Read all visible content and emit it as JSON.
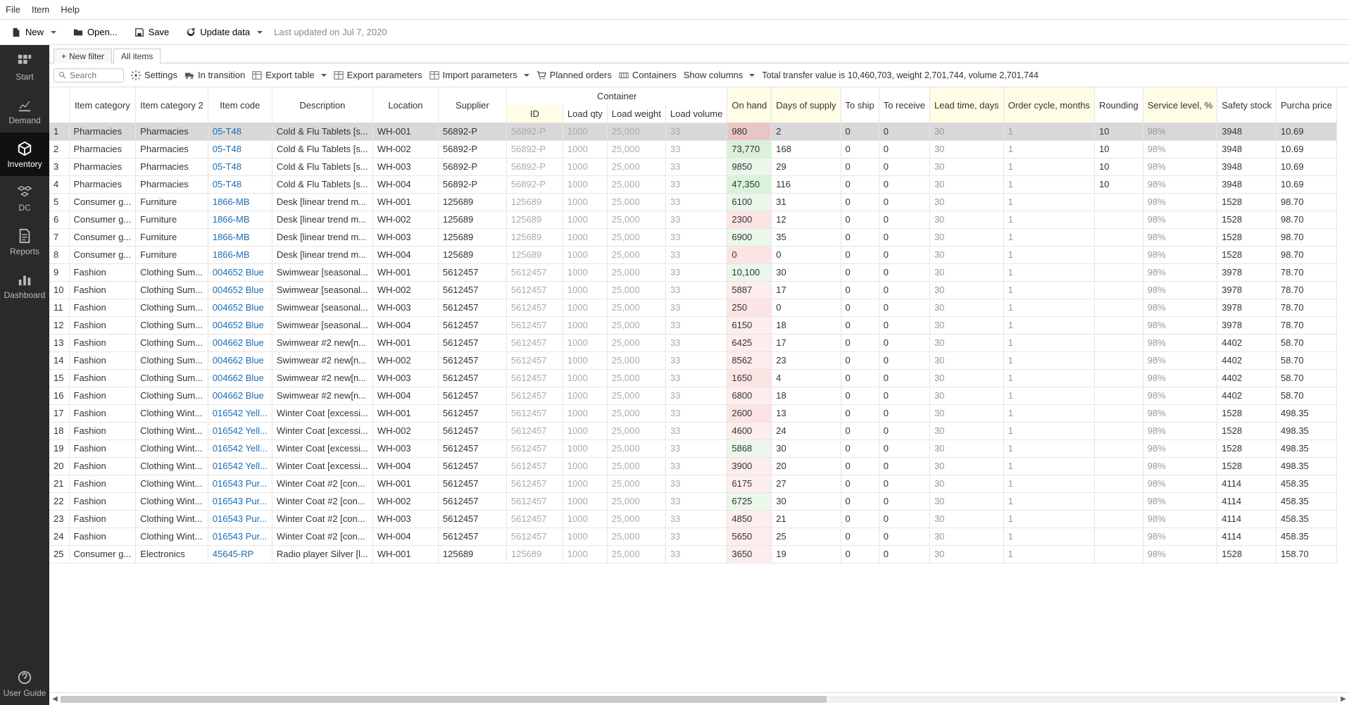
{
  "menu": {
    "file": "File",
    "item": "Item",
    "help": "Help"
  },
  "toolbar": {
    "new": "New",
    "open": "Open...",
    "save": "Save",
    "update": "Update data",
    "last_updated": "Last updated on Jul 7, 2020"
  },
  "sidebar": {
    "start": "Start",
    "demand": "Demand",
    "inventory": "Inventory",
    "dc": "DC",
    "reports": "Reports",
    "dashboard": "Dashboard",
    "guide": "User Guide"
  },
  "tabs": {
    "new_filter": "New filter",
    "all_items": "All items"
  },
  "actions": {
    "search_ph": "Search",
    "settings": "Settings",
    "in_transition": "In transition",
    "export_table": "Export table",
    "export_params": "Export parameters",
    "import_params": "Import parameters",
    "planned": "Planned orders",
    "containers": "Containers",
    "show_cols": "Show columns"
  },
  "stats": "Total transfer value is 10,460,703, weight 2,701,744, volume 2,701,744",
  "headers": {
    "cat": "Item category",
    "cat2": "Item category 2",
    "code": "Item code",
    "desc": "Description",
    "loc": "Location",
    "sup": "Supplier",
    "container": "Container",
    "cid": "ID",
    "lq": "Load qty",
    "lw": "Load weight",
    "lv": "Load volume",
    "oh": "On hand",
    "ds": "Days of supply",
    "ts": "To ship",
    "tr": "To receive",
    "lt": "Lead time, days",
    "oc": "Order cycle, months",
    "rnd": "Rounding",
    "sl": "Service level, %",
    "ss": "Safety stock",
    "pp": "Purcha price"
  },
  "rows": [
    {
      "n": 1,
      "cat": "Pharmacies",
      "cat2": "Pharmacies",
      "code": "05-T48",
      "desc": "Cold & Flu Tablets [s...",
      "loc": "WH-001",
      "sup": "56892-P",
      "cid": "56892-P",
      "lq": "1000",
      "lw": "25,000",
      "lv": "33",
      "oh": "980",
      "oh_c": "pink",
      "ds": "2",
      "ts": "0",
      "tr": "0",
      "lt": "30",
      "oc": "1",
      "rnd": "10",
      "sl": "98%",
      "ss": "3948",
      "pp": "10.69",
      "sel": true
    },
    {
      "n": 2,
      "cat": "Pharmacies",
      "cat2": "Pharmacies",
      "code": "05-T48",
      "desc": "Cold & Flu Tablets [s...",
      "loc": "WH-002",
      "sup": "56892-P",
      "cid": "56892-P",
      "lq": "1000",
      "lw": "25,000",
      "lv": "33",
      "oh": "73,770",
      "oh_c": "green",
      "ds": "168",
      "ts": "0",
      "tr": "0",
      "lt": "30",
      "oc": "1",
      "rnd": "10",
      "sl": "98%",
      "ss": "3948",
      "pp": "10.69"
    },
    {
      "n": 3,
      "cat": "Pharmacies",
      "cat2": "Pharmacies",
      "code": "05-T48",
      "desc": "Cold & Flu Tablets [s...",
      "loc": "WH-003",
      "sup": "56892-P",
      "cid": "56892-P",
      "lq": "1000",
      "lw": "25,000",
      "lv": "33",
      "oh": "9850",
      "oh_c": "lgreen",
      "ds": "29",
      "ts": "0",
      "tr": "0",
      "lt": "30",
      "oc": "1",
      "rnd": "10",
      "sl": "98%",
      "ss": "3948",
      "pp": "10.69"
    },
    {
      "n": 4,
      "cat": "Pharmacies",
      "cat2": "Pharmacies",
      "code": "05-T48",
      "desc": "Cold & Flu Tablets [s...",
      "loc": "WH-004",
      "sup": "56892-P",
      "cid": "56892-P",
      "lq": "1000",
      "lw": "25,000",
      "lv": "33",
      "oh": "47,350",
      "oh_c": "green",
      "ds": "116",
      "ts": "0",
      "tr": "0",
      "lt": "30",
      "oc": "1",
      "rnd": "10",
      "sl": "98%",
      "ss": "3948",
      "pp": "10.69"
    },
    {
      "n": 5,
      "cat": "Consumer g...",
      "cat2": "Furniture",
      "code": "1866-MB",
      "desc": "Desk [linear trend m...",
      "loc": "WH-001",
      "sup": "125689",
      "cid": "125689",
      "lq": "1000",
      "lw": "25,000",
      "lv": "33",
      "oh": "6100",
      "oh_c": "lgreen",
      "ds": "31",
      "ts": "0",
      "tr": "0",
      "lt": "30",
      "oc": "1",
      "rnd": "",
      "sl": "98%",
      "ss": "1528",
      "pp": "98.70"
    },
    {
      "n": 6,
      "cat": "Consumer g...",
      "cat2": "Furniture",
      "code": "1866-MB",
      "desc": "Desk [linear trend m...",
      "loc": "WH-002",
      "sup": "125689",
      "cid": "125689",
      "lq": "1000",
      "lw": "25,000",
      "lv": "33",
      "oh": "2300",
      "oh_c": "pink",
      "ds": "12",
      "ts": "0",
      "tr": "0",
      "lt": "30",
      "oc": "1",
      "rnd": "",
      "sl": "98%",
      "ss": "1528",
      "pp": "98.70"
    },
    {
      "n": 7,
      "cat": "Consumer g...",
      "cat2": "Furniture",
      "code": "1866-MB",
      "desc": "Desk [linear trend m...",
      "loc": "WH-003",
      "sup": "125689",
      "cid": "125689",
      "lq": "1000",
      "lw": "25,000",
      "lv": "33",
      "oh": "6900",
      "oh_c": "lgreen",
      "ds": "35",
      "ts": "0",
      "tr": "0",
      "lt": "30",
      "oc": "1",
      "rnd": "",
      "sl": "98%",
      "ss": "1528",
      "pp": "98.70"
    },
    {
      "n": 8,
      "cat": "Consumer g...",
      "cat2": "Furniture",
      "code": "1866-MB",
      "desc": "Desk [linear trend m...",
      "loc": "WH-004",
      "sup": "125689",
      "cid": "125689",
      "lq": "1000",
      "lw": "25,000",
      "lv": "33",
      "oh": "0",
      "oh_c": "pink",
      "ds": "0",
      "ts": "0",
      "tr": "0",
      "lt": "30",
      "oc": "1",
      "rnd": "",
      "sl": "98%",
      "ss": "1528",
      "pp": "98.70"
    },
    {
      "n": 9,
      "cat": "Fashion",
      "cat2": "Clothing Sum...",
      "code": "004652 Blue",
      "desc": "Swimwear [seasonal...",
      "loc": "WH-001",
      "sup": "5612457",
      "cid": "5612457",
      "lq": "1000",
      "lw": "25,000",
      "lv": "33",
      "oh": "10,100",
      "oh_c": "lgreen",
      "ds": "30",
      "ts": "0",
      "tr": "0",
      "lt": "30",
      "oc": "1",
      "rnd": "",
      "sl": "98%",
      "ss": "3978",
      "pp": "78.70"
    },
    {
      "n": 10,
      "cat": "Fashion",
      "cat2": "Clothing Sum...",
      "code": "004652 Blue",
      "desc": "Swimwear [seasonal...",
      "loc": "WH-002",
      "sup": "5612457",
      "cid": "5612457",
      "lq": "1000",
      "lw": "25,000",
      "lv": "33",
      "oh": "5887",
      "oh_c": "lpink",
      "ds": "17",
      "ts": "0",
      "tr": "0",
      "lt": "30",
      "oc": "1",
      "rnd": "",
      "sl": "98%",
      "ss": "3978",
      "pp": "78.70"
    },
    {
      "n": 11,
      "cat": "Fashion",
      "cat2": "Clothing Sum...",
      "code": "004652 Blue",
      "desc": "Swimwear [seasonal...",
      "loc": "WH-003",
      "sup": "5612457",
      "cid": "5612457",
      "lq": "1000",
      "lw": "25,000",
      "lv": "33",
      "oh": "250",
      "oh_c": "pink",
      "ds": "0",
      "ts": "0",
      "tr": "0",
      "lt": "30",
      "oc": "1",
      "rnd": "",
      "sl": "98%",
      "ss": "3978",
      "pp": "78.70"
    },
    {
      "n": 12,
      "cat": "Fashion",
      "cat2": "Clothing Sum...",
      "code": "004652 Blue",
      "desc": "Swimwear [seasonal...",
      "loc": "WH-004",
      "sup": "5612457",
      "cid": "5612457",
      "lq": "1000",
      "lw": "25,000",
      "lv": "33",
      "oh": "6150",
      "oh_c": "lpink",
      "ds": "18",
      "ts": "0",
      "tr": "0",
      "lt": "30",
      "oc": "1",
      "rnd": "",
      "sl": "98%",
      "ss": "3978",
      "pp": "78.70"
    },
    {
      "n": 13,
      "cat": "Fashion",
      "cat2": "Clothing Sum...",
      "code": "004662 Blue",
      "desc": "Swimwear #2 new[n...",
      "loc": "WH-001",
      "sup": "5612457",
      "cid": "5612457",
      "lq": "1000",
      "lw": "25,000",
      "lv": "33",
      "oh": "6425",
      "oh_c": "lpink",
      "ds": "17",
      "ts": "0",
      "tr": "0",
      "lt": "30",
      "oc": "1",
      "rnd": "",
      "sl": "98%",
      "ss": "4402",
      "pp": "58.70"
    },
    {
      "n": 14,
      "cat": "Fashion",
      "cat2": "Clothing Sum...",
      "code": "004662 Blue",
      "desc": "Swimwear #2 new[n...",
      "loc": "WH-002",
      "sup": "5612457",
      "cid": "5612457",
      "lq": "1000",
      "lw": "25,000",
      "lv": "33",
      "oh": "8562",
      "oh_c": "lpink",
      "ds": "23",
      "ts": "0",
      "tr": "0",
      "lt": "30",
      "oc": "1",
      "rnd": "",
      "sl": "98%",
      "ss": "4402",
      "pp": "58.70"
    },
    {
      "n": 15,
      "cat": "Fashion",
      "cat2": "Clothing Sum...",
      "code": "004662 Blue",
      "desc": "Swimwear #2 new[n...",
      "loc": "WH-003",
      "sup": "5612457",
      "cid": "5612457",
      "lq": "1000",
      "lw": "25,000",
      "lv": "33",
      "oh": "1650",
      "oh_c": "pink",
      "ds": "4",
      "ts": "0",
      "tr": "0",
      "lt": "30",
      "oc": "1",
      "rnd": "",
      "sl": "98%",
      "ss": "4402",
      "pp": "58.70"
    },
    {
      "n": 16,
      "cat": "Fashion",
      "cat2": "Clothing Sum...",
      "code": "004662 Blue",
      "desc": "Swimwear #2 new[n...",
      "loc": "WH-004",
      "sup": "5612457",
      "cid": "5612457",
      "lq": "1000",
      "lw": "25,000",
      "lv": "33",
      "oh": "6800",
      "oh_c": "lpink",
      "ds": "18",
      "ts": "0",
      "tr": "0",
      "lt": "30",
      "oc": "1",
      "rnd": "",
      "sl": "98%",
      "ss": "4402",
      "pp": "58.70"
    },
    {
      "n": 17,
      "cat": "Fashion",
      "cat2": "Clothing Wint...",
      "code": "016542 Yell...",
      "desc": "Winter Coat [excessi...",
      "loc": "WH-001",
      "sup": "5612457",
      "cid": "5612457",
      "lq": "1000",
      "lw": "25,000",
      "lv": "33",
      "oh": "2600",
      "oh_c": "pink",
      "ds": "13",
      "ts": "0",
      "tr": "0",
      "lt": "30",
      "oc": "1",
      "rnd": "",
      "sl": "98%",
      "ss": "1528",
      "pp": "498.35"
    },
    {
      "n": 18,
      "cat": "Fashion",
      "cat2": "Clothing Wint...",
      "code": "016542 Yell...",
      "desc": "Winter Coat [excessi...",
      "loc": "WH-002",
      "sup": "5612457",
      "cid": "5612457",
      "lq": "1000",
      "lw": "25,000",
      "lv": "33",
      "oh": "4600",
      "oh_c": "lpink",
      "ds": "24",
      "ts": "0",
      "tr": "0",
      "lt": "30",
      "oc": "1",
      "rnd": "",
      "sl": "98%",
      "ss": "1528",
      "pp": "498.35"
    },
    {
      "n": 19,
      "cat": "Fashion",
      "cat2": "Clothing Wint...",
      "code": "016542 Yell...",
      "desc": "Winter Coat [excessi...",
      "loc": "WH-003",
      "sup": "5612457",
      "cid": "5612457",
      "lq": "1000",
      "lw": "25,000",
      "lv": "33",
      "oh": "5868",
      "oh_c": "lgreen",
      "ds": "30",
      "ts": "0",
      "tr": "0",
      "lt": "30",
      "oc": "1",
      "rnd": "",
      "sl": "98%",
      "ss": "1528",
      "pp": "498.35"
    },
    {
      "n": 20,
      "cat": "Fashion",
      "cat2": "Clothing Wint...",
      "code": "016542 Yell...",
      "desc": "Winter Coat [excessi...",
      "loc": "WH-004",
      "sup": "5612457",
      "cid": "5612457",
      "lq": "1000",
      "lw": "25,000",
      "lv": "33",
      "oh": "3900",
      "oh_c": "lpink",
      "ds": "20",
      "ts": "0",
      "tr": "0",
      "lt": "30",
      "oc": "1",
      "rnd": "",
      "sl": "98%",
      "ss": "1528",
      "pp": "498.35"
    },
    {
      "n": 21,
      "cat": "Fashion",
      "cat2": "Clothing Wint...",
      "code": "016543 Pur...",
      "desc": "Winter Coat #2 [con...",
      "loc": "WH-001",
      "sup": "5612457",
      "cid": "5612457",
      "lq": "1000",
      "lw": "25,000",
      "lv": "33",
      "oh": "6175",
      "oh_c": "lpink",
      "ds": "27",
      "ts": "0",
      "tr": "0",
      "lt": "30",
      "oc": "1",
      "rnd": "",
      "sl": "98%",
      "ss": "4114",
      "pp": "458.35"
    },
    {
      "n": 22,
      "cat": "Fashion",
      "cat2": "Clothing Wint...",
      "code": "016543 Pur...",
      "desc": "Winter Coat #2 [con...",
      "loc": "WH-002",
      "sup": "5612457",
      "cid": "5612457",
      "lq": "1000",
      "lw": "25,000",
      "lv": "33",
      "oh": "6725",
      "oh_c": "lgreen",
      "ds": "30",
      "ts": "0",
      "tr": "0",
      "lt": "30",
      "oc": "1",
      "rnd": "",
      "sl": "98%",
      "ss": "4114",
      "pp": "458.35"
    },
    {
      "n": 23,
      "cat": "Fashion",
      "cat2": "Clothing Wint...",
      "code": "016543 Pur...",
      "desc": "Winter Coat #2 [con...",
      "loc": "WH-003",
      "sup": "5612457",
      "cid": "5612457",
      "lq": "1000",
      "lw": "25,000",
      "lv": "33",
      "oh": "4850",
      "oh_c": "lpink",
      "ds": "21",
      "ts": "0",
      "tr": "0",
      "lt": "30",
      "oc": "1",
      "rnd": "",
      "sl": "98%",
      "ss": "4114",
      "pp": "458.35"
    },
    {
      "n": 24,
      "cat": "Fashion",
      "cat2": "Clothing Wint...",
      "code": "016543 Pur...",
      "desc": "Winter Coat #2 [con...",
      "loc": "WH-004",
      "sup": "5612457",
      "cid": "5612457",
      "lq": "1000",
      "lw": "25,000",
      "lv": "33",
      "oh": "5650",
      "oh_c": "lpink",
      "ds": "25",
      "ts": "0",
      "tr": "0",
      "lt": "30",
      "oc": "1",
      "rnd": "",
      "sl": "98%",
      "ss": "4114",
      "pp": "458.35"
    },
    {
      "n": 25,
      "cat": "Consumer g...",
      "cat2": "Electronics",
      "code": "45645-RP",
      "desc": "Radio player Silver [l...",
      "loc": "WH-001",
      "sup": "125689",
      "cid": "125689",
      "lq": "1000",
      "lw": "25,000",
      "lv": "33",
      "oh": "3650",
      "oh_c": "lpink",
      "ds": "19",
      "ts": "0",
      "tr": "0",
      "lt": "30",
      "oc": "1",
      "rnd": "",
      "sl": "98%",
      "ss": "1528",
      "pp": "158.70"
    }
  ]
}
